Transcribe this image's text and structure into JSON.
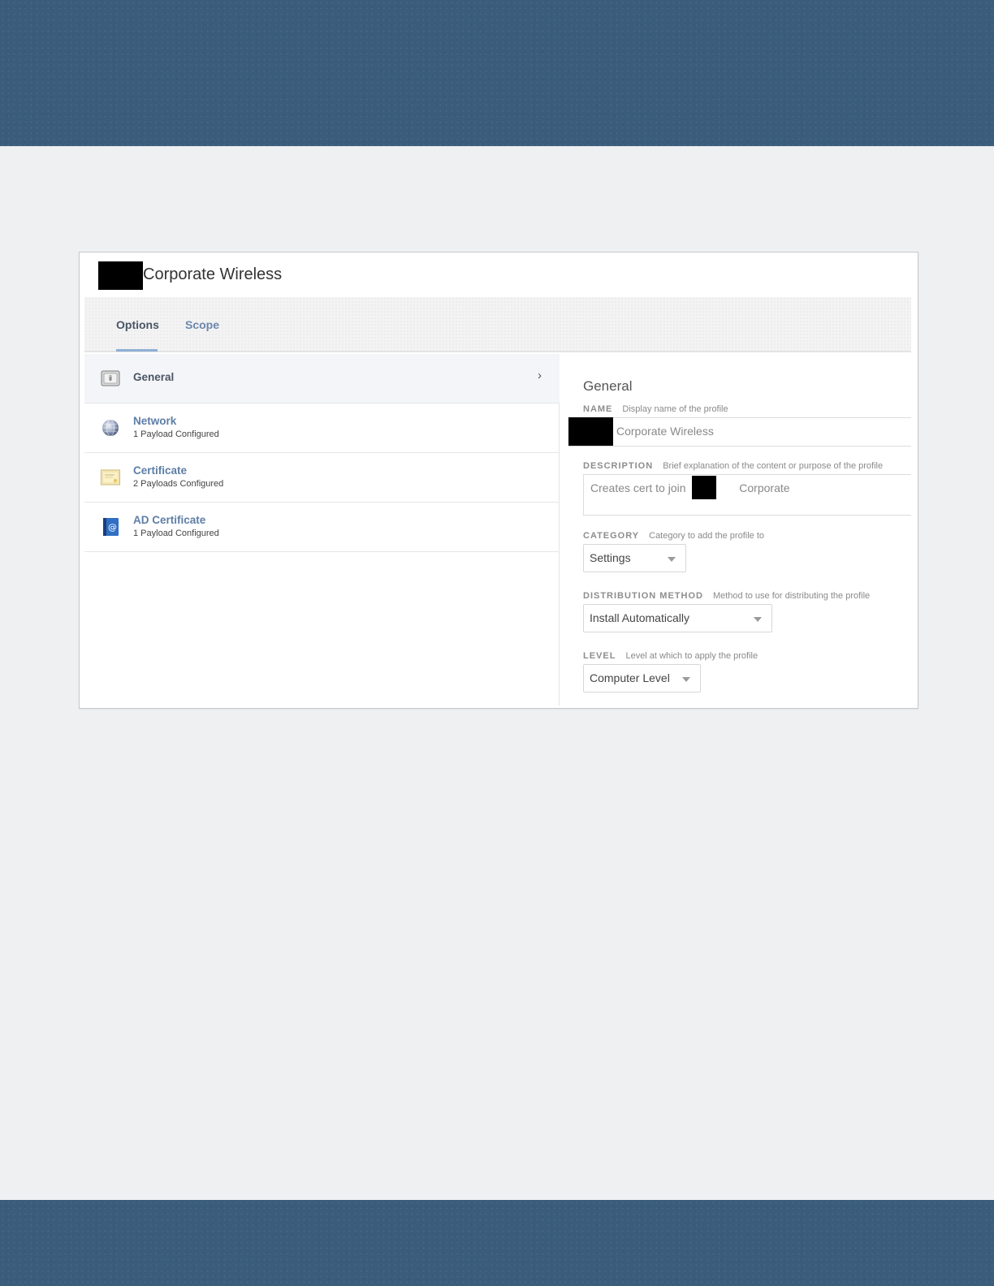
{
  "window": {
    "title": "Corporate Wireless"
  },
  "tabs": [
    {
      "label": "Options",
      "active": true
    },
    {
      "label": "Scope",
      "active": false
    }
  ],
  "payloads": [
    {
      "name": "General",
      "subtitle": "",
      "icon": "general-icon",
      "selected": true
    },
    {
      "name": "Network",
      "subtitle": "1 Payload Configured",
      "icon": "globe-icon",
      "selected": false
    },
    {
      "name": "Certificate",
      "subtitle": "2 Payloads Configured",
      "icon": "certificate-icon",
      "selected": false
    },
    {
      "name": "AD Certificate",
      "subtitle": "1 Payload Configured",
      "icon": "address-book-icon",
      "selected": false
    }
  ],
  "form": {
    "title": "General",
    "name": {
      "label": "NAME",
      "hint": "Display name of the profile",
      "value": "Corporate Wireless"
    },
    "description": {
      "label": "DESCRIPTION",
      "hint": "Brief explanation of the content or purpose of the profile",
      "value_before": "Creates cert to join",
      "value_after": "Corporate"
    },
    "category": {
      "label": "CATEGORY",
      "hint": "Category to add the profile to",
      "selected": "Settings"
    },
    "distribution": {
      "label": "DISTRIBUTION METHOD",
      "hint": "Method to use for distributing the profile",
      "selected": "Install Automatically"
    },
    "level": {
      "label": "LEVEL",
      "hint": "Level at which to apply the profile",
      "selected": "Computer Level"
    }
  },
  "colors": {
    "band": "#3b5d7c",
    "page_bg": "#eff0f2",
    "link_blue": "#5d7ea6",
    "tab_underline": "#8fb0d6"
  }
}
